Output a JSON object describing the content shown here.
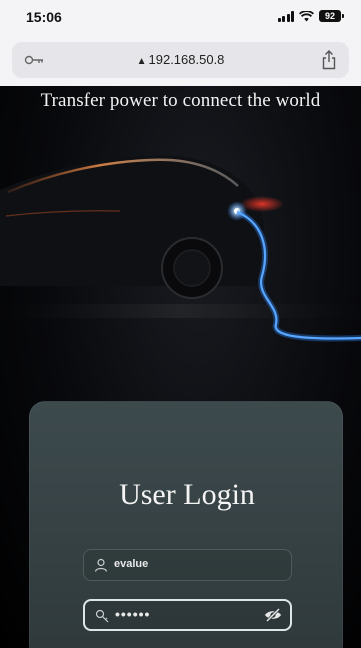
{
  "status_bar": {
    "time": "15:06",
    "battery_level": "92"
  },
  "browser": {
    "url": "192.168.50.8",
    "icons": [
      "key-icon",
      "lock-icon",
      "share-icon"
    ]
  },
  "hero": {
    "tagline": "Transfer power to connect the world"
  },
  "login": {
    "title": "User Login",
    "username_value": "evalue",
    "password_mask": "••••••",
    "icons": [
      "user-icon",
      "key-icon",
      "eye-off-icon"
    ]
  },
  "colors": {
    "accent_blue": "#2e86ff",
    "accent_red": "#d8302a",
    "card_bg": "#364245"
  }
}
